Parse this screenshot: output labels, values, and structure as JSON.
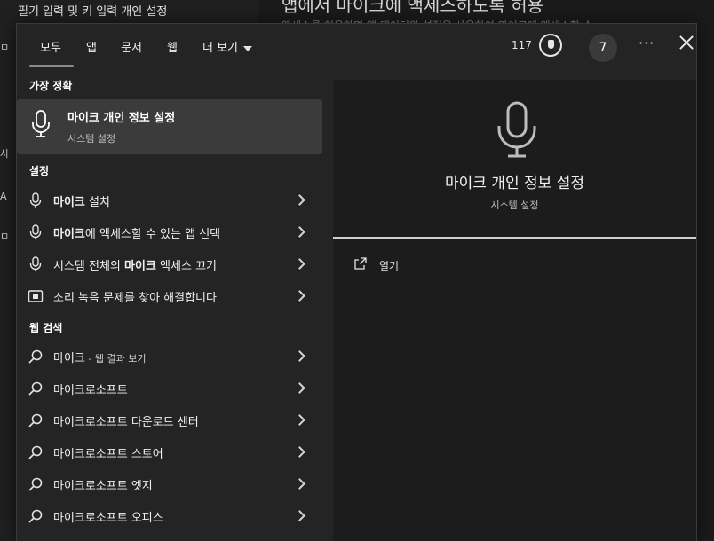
{
  "background": {
    "left_item": "필기 입력 및 키 입력 개인 설정",
    "right_title": "앱에서 마이크에 액세스하도록 허용",
    "right_subtitle": "액세스를 허용하면 앱 데이터와 설정을 사용하여 마이크에 액세스할 수",
    "edge_glyphs": [
      "ㅁ",
      "사",
      "A",
      "ㅁ"
    ]
  },
  "tabs": [
    {
      "label": "모두",
      "active": true
    },
    {
      "label": "앱"
    },
    {
      "label": "문서"
    },
    {
      "label": "웹"
    },
    {
      "label": "더 보기"
    }
  ],
  "header": {
    "points": "117",
    "avatar_initial": "7",
    "more_label": "···"
  },
  "best_match": {
    "section_label": "가장 정확",
    "title": "마이크 개인 정보 설정",
    "subtitle": "시스템 설정",
    "icon": "microphone-icon"
  },
  "settings": {
    "section_label": "설정",
    "items": [
      {
        "bold": "마이크",
        "rest": " 설치",
        "icon": "microphone-icon"
      },
      {
        "bold": "마이크",
        "rest": "에 액세스할 수 있는 앱 선택",
        "icon": "microphone-icon"
      },
      {
        "pre": "시스템 전체의 ",
        "bold": "마이크",
        "rest": " 액세스 끄기",
        "icon": "microphone-icon"
      },
      {
        "rest": "소리 녹음 문제를 찾아 해결합니다",
        "icon": "troubleshoot-icon"
      }
    ]
  },
  "web": {
    "section_label": "웹 검색",
    "items": [
      {
        "text": "마이크",
        "suffix": " - 웹 결과 보기"
      },
      {
        "text": "마이크로소프트"
      },
      {
        "text": "마이크로소프트 다운로드 센터"
      },
      {
        "text": "마이크로소프트 스토어"
      },
      {
        "text": "마이크로소프트 엣지"
      },
      {
        "text": "마이크로소프트 오피스"
      }
    ]
  },
  "preview": {
    "title": "마이크 개인 정보 설정",
    "subtitle": "시스템 설정",
    "open_label": "열기"
  },
  "colors": {
    "flyout_bg": "#242424",
    "selected_bg": "#3b3b3b",
    "preview_bg": "#1c1c1c",
    "text": "#ffffff"
  }
}
